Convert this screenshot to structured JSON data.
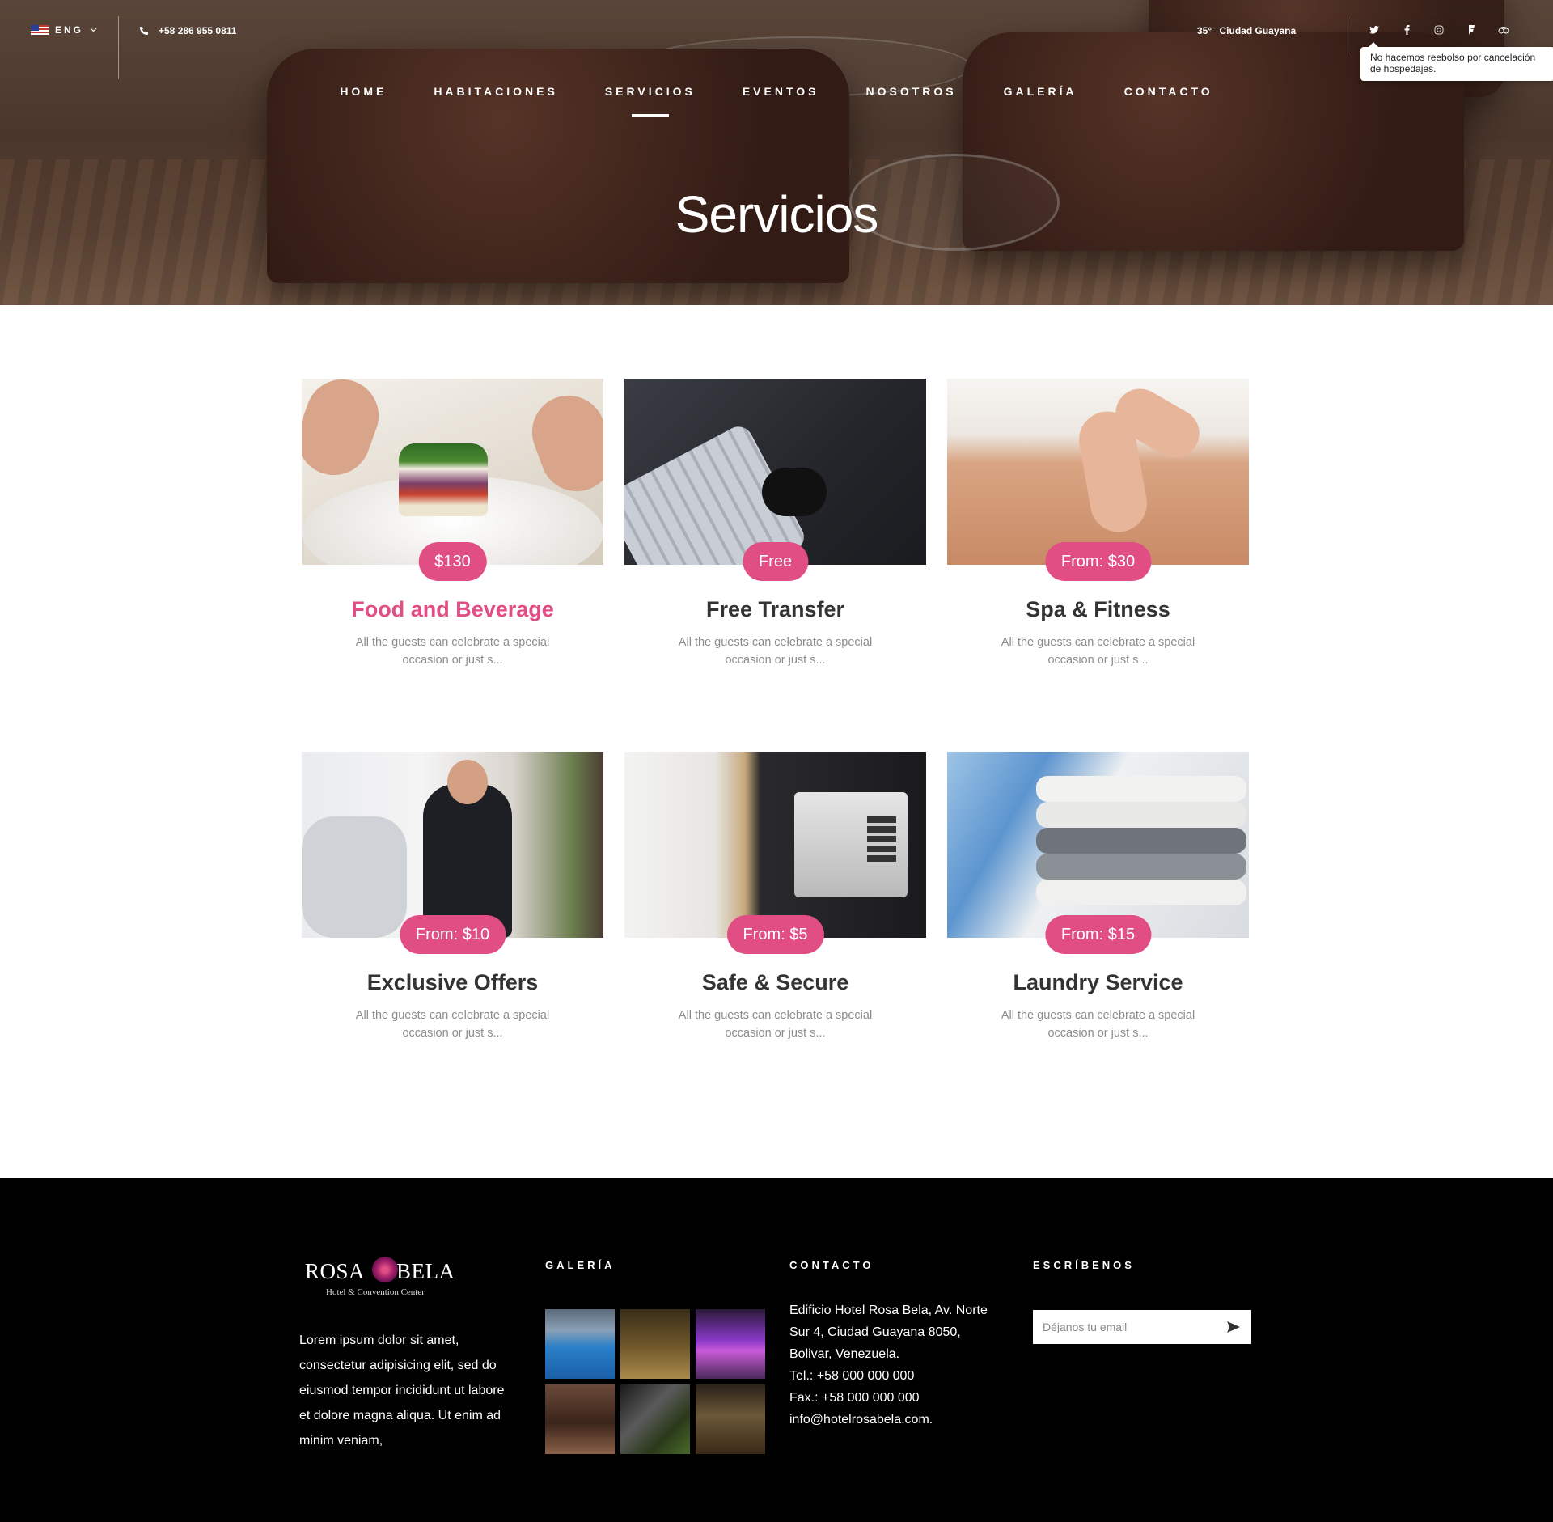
{
  "topbar": {
    "language": "ENG",
    "phone": "+58 286 955 0811",
    "temperature": "35°",
    "city": "Ciudad Guayana",
    "tooltip": "No hacemos reebolso por cancelación de hospedajes.",
    "social_icons": [
      "twitter-icon",
      "facebook-icon",
      "instagram-icon",
      "foursquare-icon",
      "tripadvisor-icon"
    ]
  },
  "nav": {
    "items": [
      "HOME",
      "HABITACIONES",
      "SERVICIOS",
      "EVENTOS",
      "NOSOTROS",
      "GALERÍA",
      "CONTACTO"
    ],
    "active": "SERVICIOS"
  },
  "hero": {
    "title": "Servicios"
  },
  "services": [
    {
      "price": "$130",
      "title": "Food and Beverage",
      "desc": "All the guests can celebrate a special occasion or just s..."
    },
    {
      "price": "Free",
      "title": "Free Transfer",
      "desc": "All the guests can celebrate a special occasion or just s..."
    },
    {
      "price": "From: $30",
      "title": "Spa & Fitness",
      "desc": "All the guests can celebrate a special occasion or just s..."
    },
    {
      "price": "From: $10",
      "title": "Exclusive Offers",
      "desc": "All the guests can celebrate a special occasion or just s..."
    },
    {
      "price": "From: $5",
      "title": "Safe & Secure",
      "desc": "All the guests can celebrate a special occasion or just s..."
    },
    {
      "price": "From: $15",
      "title": "Laundry Service",
      "desc": "All the guests can celebrate a special occasion or just s..."
    }
  ],
  "footer": {
    "logo_left": "ROSA",
    "logo_right": "BELA",
    "logo_sub": "Hotel & Convention Center",
    "about": "Lorem ipsum dolor sit amet, consectetur adipisicing elit, sed do eiusmod tempor incididunt ut labore et dolore magna aliqua. Ut enim ad minim veniam,",
    "gallery_title": "GALERÍA",
    "contact_title": "CONTACTO",
    "contact_lines": [
      "Edificio Hotel Rosa Bela, Av. Norte",
      "Sur 4, Ciudad Guayana 8050,",
      "Bolivar, Venezuela.",
      "Tel.: +58 000 000 000",
      "Fax.: +58 000 000 000",
      "info@hotelrosabela.com."
    ],
    "newsletter_title": "ESCRÍBENOS",
    "email_placeholder": "Déjanos tu email"
  },
  "colors": {
    "accent": "#e04e84",
    "footer_bg": "#000000",
    "muted_text": "#8c8c8c"
  }
}
